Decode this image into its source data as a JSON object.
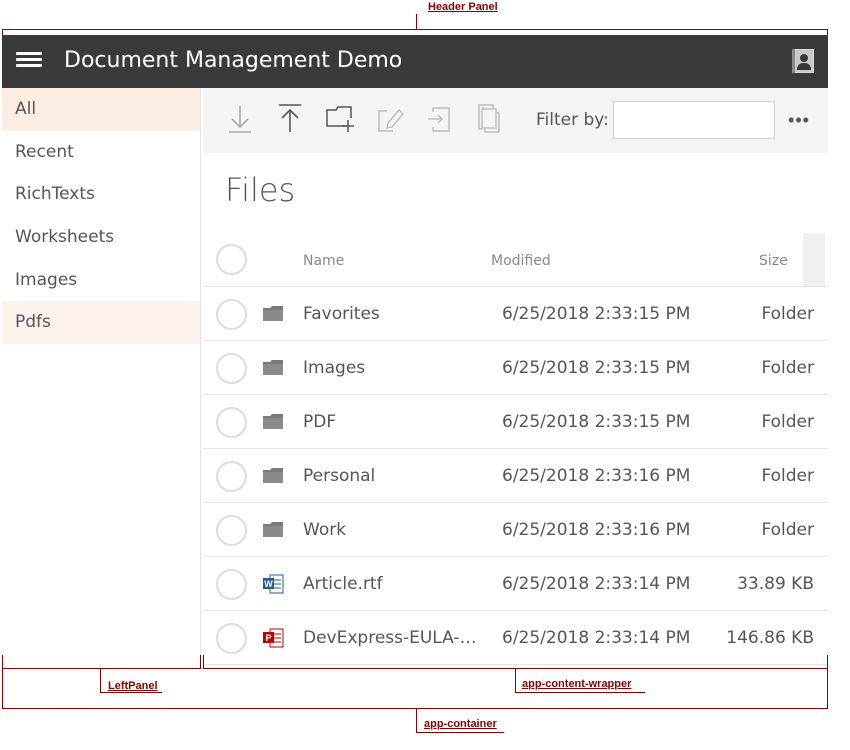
{
  "annotations": {
    "header_panel": "Header Panel",
    "left_panel": "LeftPanel",
    "content_wrapper": "app-content-wrapper",
    "container": "app-container"
  },
  "header": {
    "title": "Document Management Demo",
    "menu_icon": "hamburger-menu-icon",
    "user_icon": "user-account-icon",
    "background": "#3a3a3a"
  },
  "sidebar": {
    "items": [
      {
        "label": "All",
        "state": "selected"
      },
      {
        "label": "Recent",
        "state": ""
      },
      {
        "label": "RichTexts",
        "state": ""
      },
      {
        "label": "Worksheets",
        "state": ""
      },
      {
        "label": "Images",
        "state": ""
      },
      {
        "label": "Pdfs",
        "state": "hover"
      }
    ],
    "selected_color": "#fdeee4"
  },
  "toolbar": {
    "buttons": [
      {
        "icon": "download-icon",
        "enabled": false
      },
      {
        "icon": "upload-icon",
        "enabled": true
      },
      {
        "icon": "new-folder-icon",
        "enabled": true
      },
      {
        "icon": "rename-icon",
        "enabled": false
      },
      {
        "icon": "move-to-icon",
        "enabled": false
      },
      {
        "icon": "copy-icon",
        "enabled": false
      }
    ],
    "filter_label": "Filter by:",
    "filter_value": "",
    "more_label": "•••"
  },
  "main": {
    "title": "Files",
    "columns": {
      "name": "Name",
      "modified": "Modified",
      "size": "Size"
    },
    "rows": [
      {
        "type": "folder",
        "name": "Favorites",
        "modified": "6/25/2018 2:33:15 PM",
        "size": "Folder"
      },
      {
        "type": "folder",
        "name": "Images",
        "modified": "6/25/2018 2:33:15 PM",
        "size": "Folder"
      },
      {
        "type": "folder",
        "name": "PDF",
        "modified": "6/25/2018 2:33:15 PM",
        "size": "Folder"
      },
      {
        "type": "folder",
        "name": "Personal",
        "modified": "6/25/2018 2:33:16 PM",
        "size": "Folder"
      },
      {
        "type": "folder",
        "name": "Work",
        "modified": "6/25/2018 2:33:16 PM",
        "size": "Folder"
      },
      {
        "type": "word",
        "name": "Article.rtf",
        "modified": "6/25/2018 2:33:14 PM",
        "size": "33.89 KB"
      },
      {
        "type": "pdf",
        "name": "DevExpress-EULA-N...",
        "modified": "6/25/2018 2:33:14 PM",
        "size": "146.86 KB"
      }
    ]
  }
}
